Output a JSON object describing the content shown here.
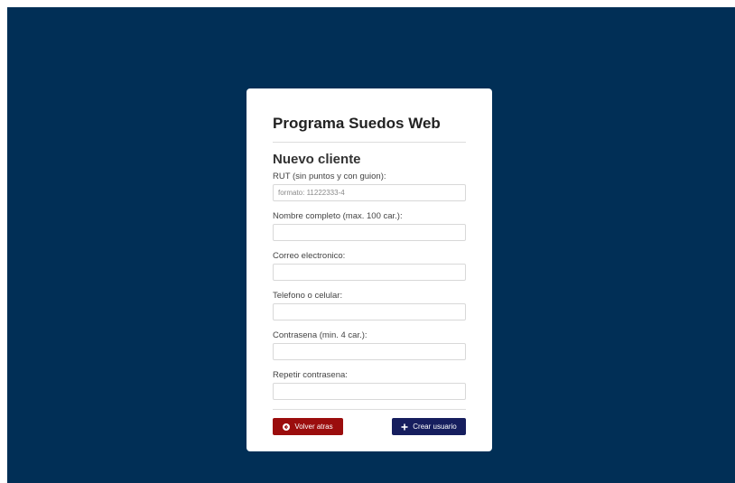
{
  "app": {
    "title": "Programa Suedos Web"
  },
  "form": {
    "title": "Nuevo cliente",
    "fields": [
      {
        "label": "RUT (sin puntos y con guion):",
        "placeholder": "formato: 11222333-4",
        "value": ""
      },
      {
        "label": "Nombre completo (max. 100 car.):",
        "placeholder": "",
        "value": ""
      },
      {
        "label": "Correo electronico:",
        "placeholder": "",
        "value": ""
      },
      {
        "label": "Telefono o celular:",
        "placeholder": "",
        "value": ""
      },
      {
        "label": "Contrasena (min. 4 car.):",
        "placeholder": "",
        "value": ""
      },
      {
        "label": "Repetir contrasena:",
        "placeholder": "",
        "value": ""
      }
    ]
  },
  "actions": {
    "back_label": "Volver atras",
    "back_icon": "arrow-left-circle-icon",
    "create_label": "Crear usuario",
    "create_icon": "plus-icon"
  },
  "colors": {
    "background": "#012f56",
    "back_button": "#9b0d0d",
    "create_button": "#161e5e"
  }
}
